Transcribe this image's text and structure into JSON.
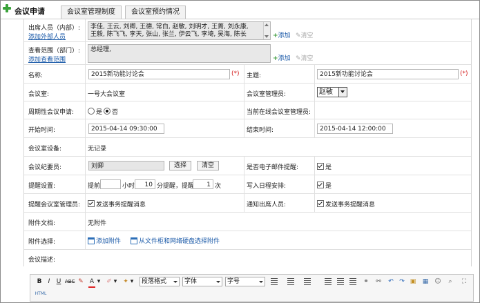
{
  "header": {
    "title": "会议申请",
    "tabs": [
      "会议室管理制度",
      "会议室预约情况"
    ]
  },
  "attendees": {
    "label": "出席人员（内部）:",
    "external_link": "添加外部人员",
    "line1": "李佳, 王云, 刘卿, 王德, 常白, 赵敏, 刘明才, 王菁, 刘永康,",
    "line2": "王毅, 陈飞飞, 李天, 张山, 张兰, 伊云飞, 李埼, 吴海, 陈长",
    "add": "添加",
    "clear": "清空"
  },
  "scope": {
    "label": "查看范围（部门）:",
    "add_link": "添加查看范围",
    "value": "总经理,"
  },
  "name": {
    "label": "名称:",
    "value": "2015新功能讨论会",
    "required": "(*)"
  },
  "subject": {
    "label": "主题:",
    "value": "2015新功能讨论会",
    "required": "(*)"
  },
  "room": {
    "label": "会议室:",
    "value": "一号大会议室"
  },
  "room_admin": {
    "label": "会议室管理员:",
    "value": "赵敏"
  },
  "periodic": {
    "label": "周期性会议申请:",
    "yes": "是",
    "no": "否",
    "selected": "否"
  },
  "online_admin": {
    "label": "当前在线会议室管理员:"
  },
  "start": {
    "label": "开始时间:",
    "value": "2015-04-14 09:30:00"
  },
  "end": {
    "label": "结束时间:",
    "value": "2015-04-14 12:00:00"
  },
  "equipment": {
    "label": "会议室设备:",
    "value": "无记录"
  },
  "recorder": {
    "label": "会议纪要员:",
    "value": "刘卿",
    "select": "选择",
    "clear": "清空"
  },
  "email_remind": {
    "label": "是否电子邮件提醒:",
    "option": "是",
    "checked": true
  },
  "remind": {
    "label": "提醒设置:",
    "prefix": "提前",
    "hours_unit": "小时",
    "minutes": "10",
    "minutes_unit": "分提醒，提醒",
    "times": "1",
    "times_unit": "次"
  },
  "schedule": {
    "label": "写入日程安排:",
    "option": "是",
    "checked": true
  },
  "remind_admin": {
    "label": "提醒会议室管理员:",
    "option": "发送事务提醒消息",
    "checked": true
  },
  "notify_attendees": {
    "label": "通知出席人员:",
    "option": "发送事务提醒消息",
    "checked": true
  },
  "attachments": {
    "label": "附件文档:",
    "value": "无附件"
  },
  "attach_select": {
    "label": "附件选择:",
    "add": "添加附件",
    "from_cabinet": "从文件柜和网络硬盘选择附件"
  },
  "description": {
    "label": "会议描述:"
  },
  "editor": {
    "bold": "B",
    "italic": "I",
    "underline": "U",
    "strike": "ABC",
    "font_color": "A",
    "format": "段落格式",
    "font": "字体",
    "size": "字号",
    "html": "HTML"
  }
}
